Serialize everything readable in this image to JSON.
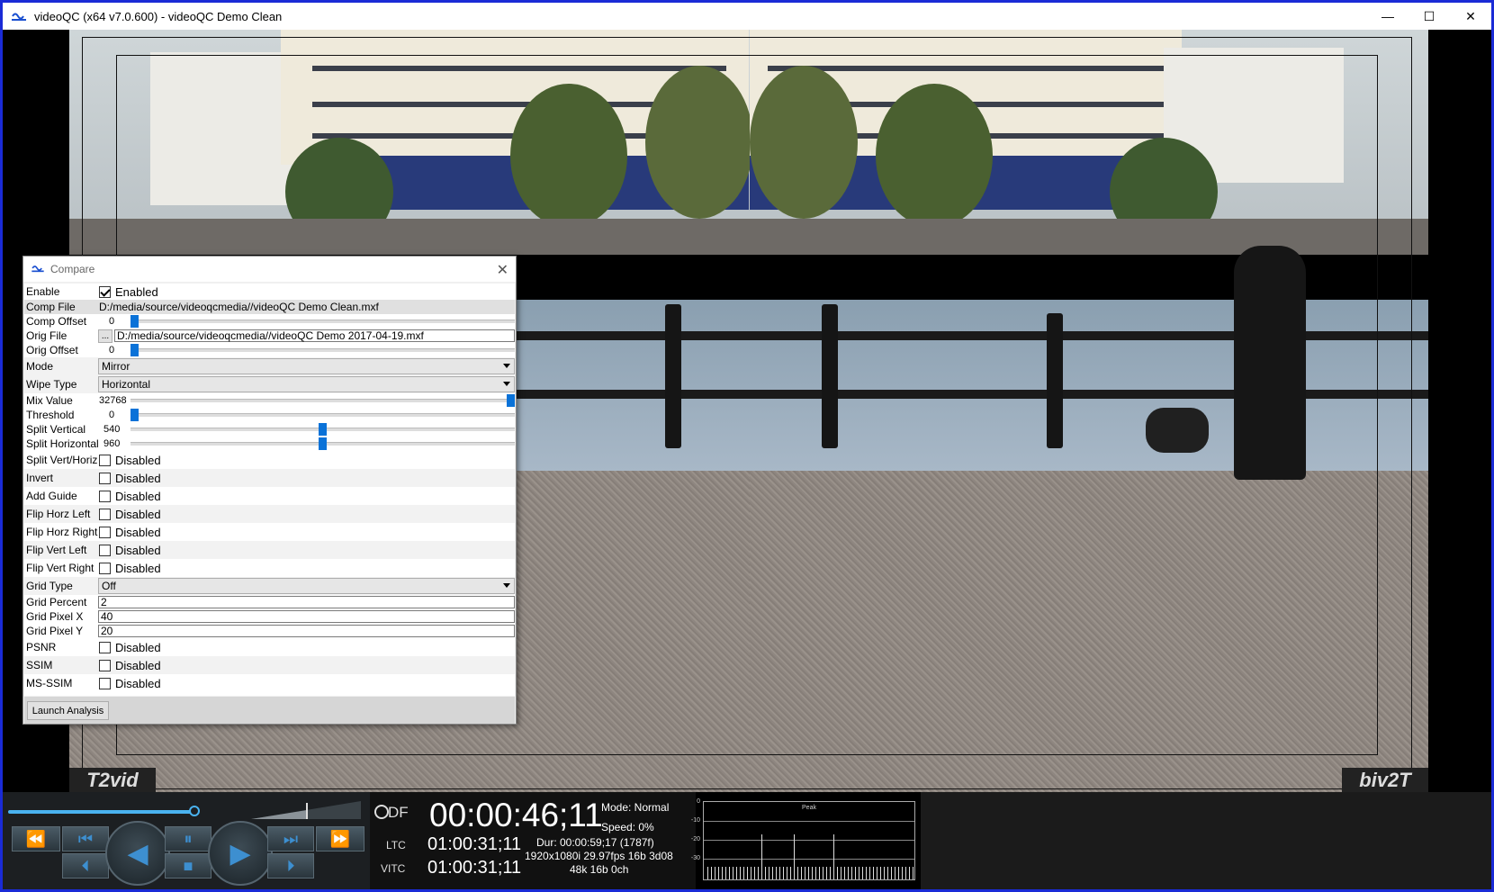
{
  "window": {
    "title": "videoQC (x64 v7.0.600) - videoQC Demo Clean",
    "minimize_glyph": "—",
    "maximize_glyph": "☐",
    "close_glyph": "✕"
  },
  "video": {
    "logo_left": "T2vid",
    "logo_right": "biv2T"
  },
  "compare": {
    "title": "Compare",
    "close_glyph": "✕",
    "rows": {
      "enable": {
        "label": "Enable",
        "checked": true,
        "text": "Enabled"
      },
      "comp_file": {
        "label": "Comp File",
        "value": "D:/media/source/videoqcmedia//videoQC Demo Clean.mxf"
      },
      "comp_offset": {
        "label": "Comp Offset",
        "value": "0",
        "fraction": 0.0
      },
      "orig_file": {
        "label": "Orig File",
        "button": "...",
        "value": "D:/media/source/videoqcmedia//videoQC Demo 2017-04-19.mxf"
      },
      "orig_offset": {
        "label": "Orig Offset",
        "value": "0",
        "fraction": 0.0
      },
      "mode": {
        "label": "Mode",
        "value": "Mirror"
      },
      "wipe_type": {
        "label": "Wipe Type",
        "value": "Horizontal"
      },
      "mix_value": {
        "label": "Mix Value",
        "value": "32768",
        "fraction": 1.0
      },
      "threshold": {
        "label": "Threshold",
        "value": "0",
        "fraction": 0.0
      },
      "split_vertical": {
        "label": "Split Vertical",
        "value": "540",
        "fraction": 0.5
      },
      "split_horizontal": {
        "label": "Split Horizontal",
        "value": "960",
        "fraction": 0.5
      },
      "split_vert_horiz": {
        "label": "Split Vert/Horiz",
        "text": "Disabled"
      },
      "invert": {
        "label": "Invert",
        "text": "Disabled"
      },
      "add_guide": {
        "label": "Add Guide",
        "text": "Disabled"
      },
      "flip_horz_left": {
        "label": "Flip Horz Left",
        "text": "Disabled"
      },
      "flip_horz_right": {
        "label": "Flip Horz Right",
        "text": "Disabled"
      },
      "flip_vert_left": {
        "label": "Flip Vert Left",
        "text": "Disabled"
      },
      "flip_vert_right": {
        "label": "Flip Vert Right",
        "text": "Disabled"
      },
      "grid_type": {
        "label": "Grid Type",
        "value": "Off"
      },
      "grid_percent": {
        "label": "Grid Percent",
        "value": "2"
      },
      "grid_pixel_x": {
        "label": "Grid Pixel X",
        "value": "40"
      },
      "grid_pixel_y": {
        "label": "Grid Pixel Y",
        "value": "20"
      },
      "psnr": {
        "label": "PSNR",
        "text": "Disabled"
      },
      "ssim": {
        "label": "SSIM",
        "text": "Disabled"
      },
      "ms_ssim": {
        "label": "MS-SSIM",
        "text": "Disabled"
      }
    },
    "launch_button": "Launch Analysis"
  },
  "transport": {
    "seek_fraction": 0.53,
    "df_label": "DF",
    "timecode": "00:00:46;11",
    "mode": "Mode: Normal",
    "speed": "Speed: 0%",
    "ltc_label": "LTC",
    "ltc_value": "01:00:31;11",
    "vitc_label": "VITC",
    "vitc_value": "01:00:31;11",
    "duration": "Dur: 00:00:59;17 (1787f)",
    "format": "1920x1080i 29.97fps 16b 3d08",
    "audio": "48k 16b 0ch",
    "accent_color": "#3d8fd0"
  },
  "peak_meter": {
    "title": "Peak",
    "ticks": [
      "0",
      "-10",
      "-20",
      "-30"
    ]
  }
}
